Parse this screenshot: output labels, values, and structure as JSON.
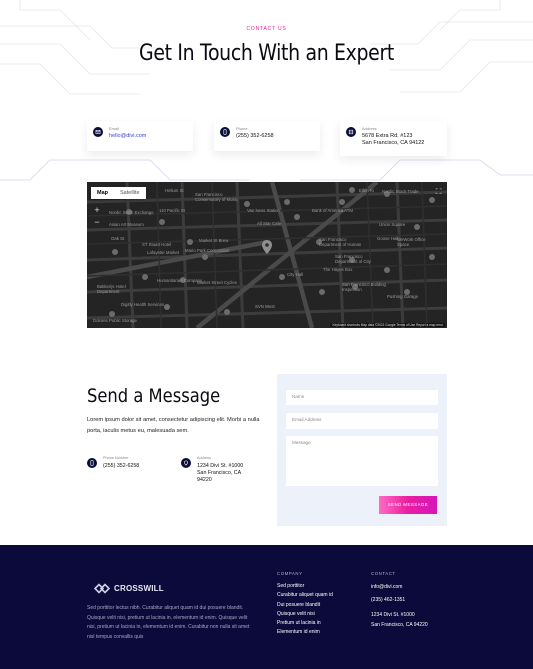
{
  "header": {
    "eyebrow": "CONTACT US",
    "title": "Get In Touch With an Expert"
  },
  "cards": [
    {
      "label": "Email",
      "value": "hello@divi.com",
      "icon": "email-icon"
    },
    {
      "label": "Phone",
      "value": "(255) 352-6258",
      "icon": "phone-icon"
    },
    {
      "label": "Address",
      "value_line1": "5678 Extra Rd. #123",
      "value_line2": "San Francisco, CA 94122",
      "icon": "location-icon"
    }
  ],
  "map": {
    "tab_map": "Map",
    "tab_satellite": "Satellite",
    "zoom_in": "+",
    "zoom_out": "−",
    "footer": "Keyboard shortcuts   Map data ©2021 Google   Terms of Use   Report a map error",
    "labels": [
      "Helium St",
      "San Francisco Conservatory of Music",
      "Van Ness Station",
      "Bank of America ATM",
      "Ellen Ri",
      "Nordic Stock Trade",
      "Nordic Stock Exchange",
      "Union Square",
      "110 Pacific St",
      "Asian Art Museum",
      "All Star Cafe",
      "ST Stuart Hotel",
      "Oak St",
      "San Francisco Department of Human",
      "Goose Hall",
      "Market St Brew",
      "Lafayette Market",
      "WeWork Office Space",
      "Mario Park Corporation",
      "San Francisco Department of City",
      "The Hayes Box",
      "Humanitarian Company",
      "Bakkerijs Hotel Department",
      "Market Street Cycles",
      "San Francisco Building Inspection",
      "City Hall",
      "Digitly Health Services",
      "Pushing Garage",
      "Dolores Public Storage",
      "SVN West"
    ]
  },
  "message": {
    "title": "Send a Message",
    "body": "Lorem ipsum dolor sit amet, consectetur adipiscing elit. Morbi a nulla porta, iaculis metus eu, malesuada sem.",
    "phone_label": "Phone Number",
    "phone_value": "(255) 352-6258",
    "address_label": "Address",
    "address_line1": "1234 Divi St. #1000",
    "address_line2": "San Francisco, CA",
    "address_line3": "94220"
  },
  "form": {
    "name_placeholder": "Name",
    "email_placeholder": "Email Address",
    "message_placeholder": "Message",
    "submit_label": "SEND MESSAGE"
  },
  "footer": {
    "brand": "CROSSWILL",
    "about": "Sed porttitor lectus nibh. Curabitur aliquet quam id dui posuere blandit. Quisque velit nisi, pretium ut lacinia in, elementum id enim. Quisque velit nisi, pretium ut lacinia in, elementum id enim. Curabitur non nulla sit amet nisl tempus convallis quis",
    "company_heading": "COMPANY",
    "company_links": [
      "Sed porttitor",
      "Curabitur aliquet quam id",
      "Dui posuere blandit",
      "Quisque velit nisi",
      "Pretium ut lacinia in",
      "Elementum id enim"
    ],
    "contact_heading": "CONTACT",
    "contact_email": "info@divi.com",
    "contact_phone": "(235) 462-1351",
    "contact_address1": "1234 Divi St. #1000",
    "contact_address2": "San Francisco, CA 94220"
  },
  "colors": {
    "accent": "#e01fa0",
    "navy": "#0b0a3a",
    "form_bg": "#edf2fa"
  }
}
